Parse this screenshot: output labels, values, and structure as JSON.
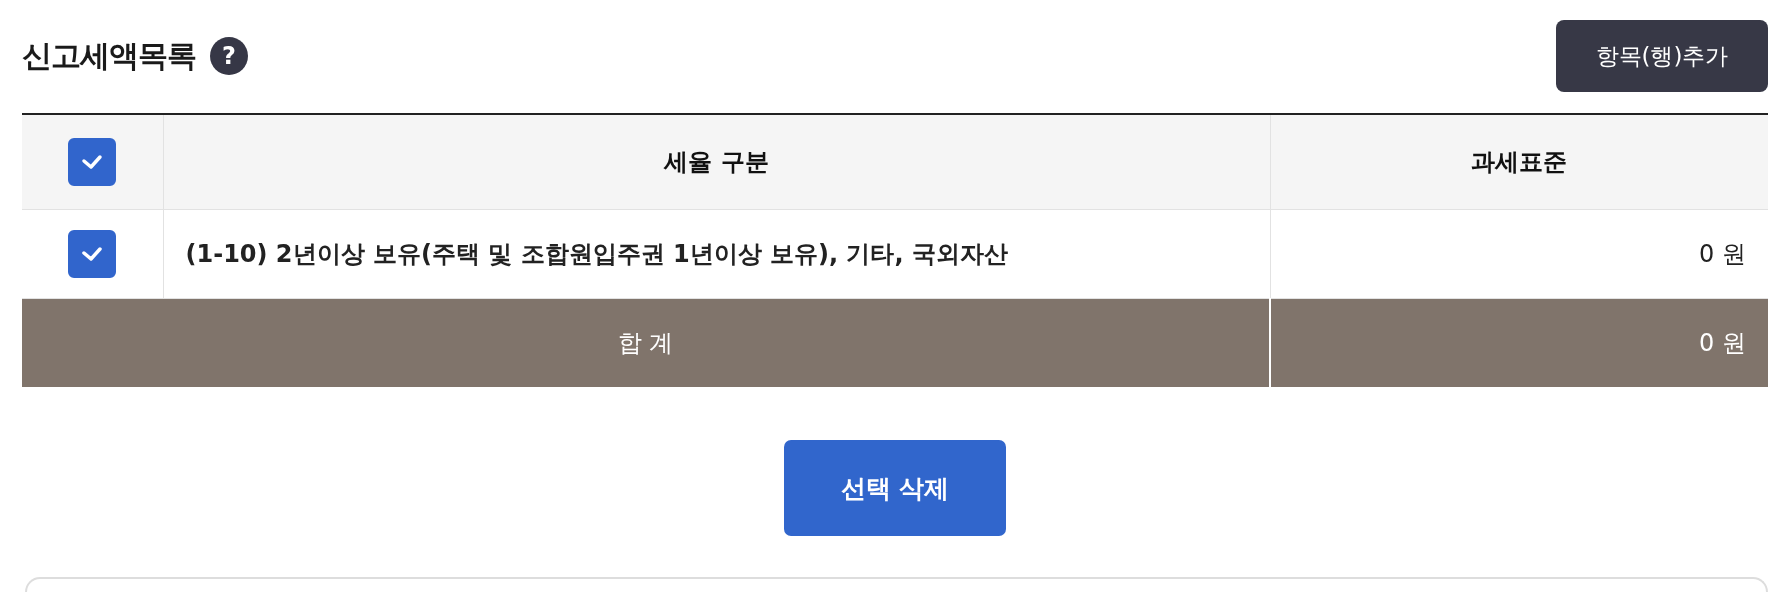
{
  "section": {
    "title": "신고세액목록",
    "help_icon": "?"
  },
  "add_button": "항목(행)추가",
  "table": {
    "select_all": {
      "checked": true
    },
    "columns": [
      "세율 구분",
      "과세표준"
    ],
    "rows": [
      {
        "checked": true,
        "category": "(1-10) 2년이상 보유(주택 및 조합원입주권 1년이상 보유), 기타, 국외자산",
        "tax_base": "0 원"
      }
    ],
    "total": {
      "label": "합 계",
      "tax_base": "0 원"
    }
  },
  "delete_button": "선택 삭제"
}
